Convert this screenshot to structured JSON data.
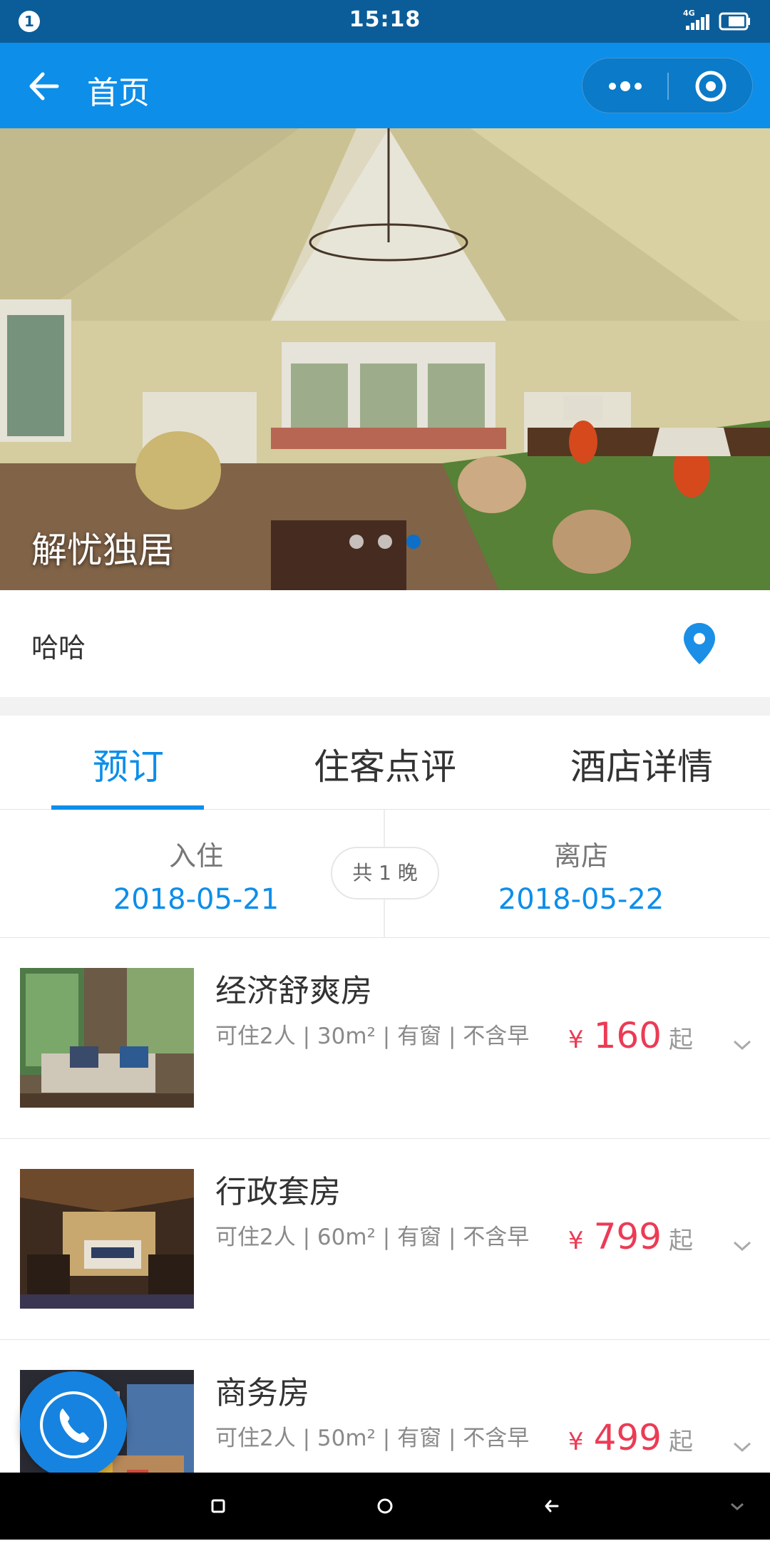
{
  "status_bar": {
    "notification_count": "1",
    "time": "15:18",
    "network": "4G",
    "icons": [
      "notification-badge",
      "signal-icon",
      "battery-icon"
    ]
  },
  "nav": {
    "title": "首页",
    "icons": [
      "back-arrow-icon",
      "more-dots-icon",
      "target-icon"
    ]
  },
  "banner": {
    "caption": "解忧独居",
    "dots_total": 3,
    "active_dot": 3
  },
  "location": {
    "name": "哈哈",
    "icon": "location-pin-icon"
  },
  "tabs": [
    {
      "label": "预订",
      "active": true
    },
    {
      "label": "住客点评",
      "active": false
    },
    {
      "label": "酒店详情",
      "active": false
    }
  ],
  "dates": {
    "checkin_label": "入住",
    "checkin_value": "2018-05-21",
    "nights_label": "共 1 晚",
    "checkout_label": "离店",
    "checkout_value": "2018-05-22"
  },
  "rooms": [
    {
      "name": "经济舒爽房",
      "spec": "可住2人 | 30m² | 有窗 | 不含早",
      "currency": "¥",
      "price": "160",
      "suffix": "起"
    },
    {
      "name": "行政套房",
      "spec": "可住2人 | 60m² | 有窗 | 不含早",
      "currency": "¥",
      "price": "799",
      "suffix": "起"
    },
    {
      "name": "商务房",
      "spec": "可住2人 | 50m² | 有窗 | 不含早",
      "currency": "¥",
      "price": "499",
      "suffix": "起"
    }
  ],
  "colors": {
    "primary": "#0d8ee9",
    "status_bar": "#0b5d99",
    "price": "#ec3b55"
  },
  "fab": {
    "icon": "phone-icon"
  },
  "system_nav": {
    "icons": [
      "recents-square-icon",
      "home-circle-icon",
      "back-icon",
      "collapse-chevron-icon"
    ]
  }
}
